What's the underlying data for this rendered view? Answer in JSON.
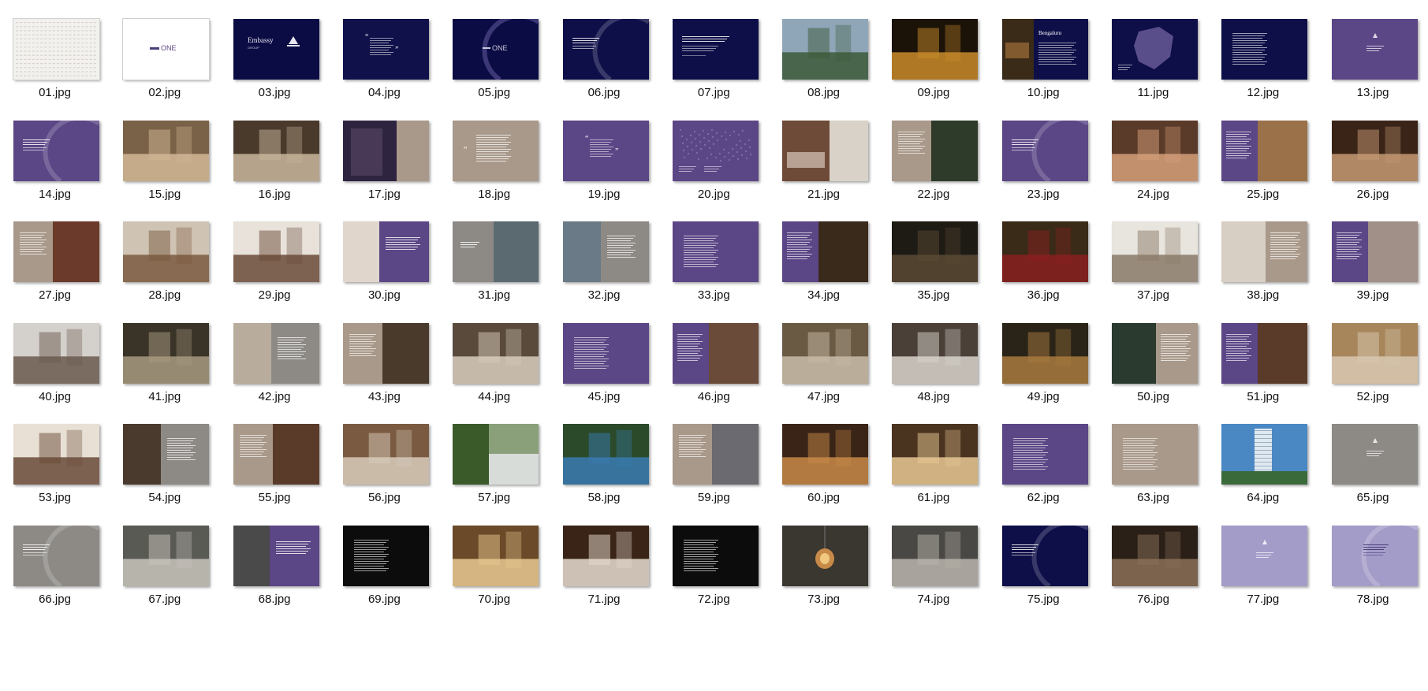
{
  "window": {
    "view": "large-icons",
    "background": "#ffffff"
  },
  "files": [
    {
      "name": "01.jpg",
      "kind": "text-texture",
      "bg": "#f3f1ee"
    },
    {
      "name": "02.jpg",
      "kind": "logo-light",
      "bg": "#ffffff"
    },
    {
      "name": "03.jpg",
      "kind": "logo-dark",
      "bg": "#0c0c45"
    },
    {
      "name": "04.jpg",
      "kind": "quote",
      "bg": "#10104a"
    },
    {
      "name": "05.jpg",
      "kind": "logo-arc",
      "bg": "#0c0c45"
    },
    {
      "name": "06.jpg",
      "kind": "heading-arc",
      "bg": "#0e0e48"
    },
    {
      "name": "07.jpg",
      "kind": "heading",
      "bg": "#0e0e48"
    },
    {
      "name": "08.jpg",
      "kind": "photo",
      "bg": "#8fa6b8",
      "bg2": "#3d5a3a"
    },
    {
      "name": "09.jpg",
      "kind": "photo",
      "bg": "#1b1208",
      "bg2": "#c98b2a"
    },
    {
      "name": "10.jpg",
      "kind": "split-photo-dark",
      "bg": "#0e0e48",
      "bg2": "#3a2a18"
    },
    {
      "name": "11.jpg",
      "kind": "map",
      "bg": "#0e0e48",
      "bg2": "#5a4e8a"
    },
    {
      "name": "12.jpg",
      "kind": "text-dark",
      "bg": "#0e0e48"
    },
    {
      "name": "13.jpg",
      "kind": "logo-purple",
      "bg": "#5b4686"
    },
    {
      "name": "14.jpg",
      "kind": "heading-arc",
      "bg": "#5b4686"
    },
    {
      "name": "15.jpg",
      "kind": "photo",
      "bg": "#7a6248",
      "bg2": "#d2b896"
    },
    {
      "name": "16.jpg",
      "kind": "photo",
      "bg": "#4a3a2c",
      "bg2": "#c8b69c"
    },
    {
      "name": "17.jpg",
      "kind": "split-photo-taupe",
      "bg": "#2e2440",
      "bg2": "#a9998a"
    },
    {
      "name": "18.jpg",
      "kind": "quote-taupe",
      "bg": "#a9998a"
    },
    {
      "name": "19.jpg",
      "kind": "quote",
      "bg": "#5b4686"
    },
    {
      "name": "20.jpg",
      "kind": "map-world",
      "bg": "#5b4686",
      "bg2": "#7d6ba3"
    },
    {
      "name": "21.jpg",
      "kind": "split-photo-light",
      "bg": "#6e4a38",
      "bg2": "#d8d2c8"
    },
    {
      "name": "22.jpg",
      "kind": "split-photo-taupe-left",
      "bg": "#a9998a",
      "bg2": "#2e3a2a"
    },
    {
      "name": "23.jpg",
      "kind": "heading-arc",
      "bg": "#5b4686"
    },
    {
      "name": "24.jpg",
      "kind": "photo",
      "bg": "#5a3a28",
      "bg2": "#d6a07a"
    },
    {
      "name": "25.jpg",
      "kind": "split-photo-purple",
      "bg": "#5b4686",
      "bg2": "#9a7148"
    },
    {
      "name": "26.jpg",
      "kind": "photo",
      "bg": "#3a2418",
      "bg2": "#c79a74"
    },
    {
      "name": "27.jpg",
      "kind": "split-photo-taupe-left",
      "bg": "#a9998a",
      "bg2": "#6b3a2a"
    },
    {
      "name": "28.jpg",
      "kind": "photo",
      "bg": "#cfc4b4",
      "bg2": "#7a5a40"
    },
    {
      "name": "29.jpg",
      "kind": "photo",
      "bg": "#e8e2da",
      "bg2": "#6a4a38"
    },
    {
      "name": "30.jpg",
      "kind": "split-photo-purple-right",
      "bg": "#5b4686",
      "bg2": "#e0d6cc"
    },
    {
      "name": "31.jpg",
      "kind": "split-photo-grey",
      "bg": "#8d8a86",
      "bg2": "#5a6a70"
    },
    {
      "name": "32.jpg",
      "kind": "split-photo-grey-right",
      "bg": "#8d8a86",
      "bg2": "#6a7a86"
    },
    {
      "name": "33.jpg",
      "kind": "text-purple",
      "bg": "#5b4686"
    },
    {
      "name": "34.jpg",
      "kind": "split-photo-purple",
      "bg": "#5b4686",
      "bg2": "#3a2a1c"
    },
    {
      "name": "35.jpg",
      "kind": "photo",
      "bg": "#1e1a14",
      "bg2": "#5a4a34"
    },
    {
      "name": "36.jpg",
      "kind": "photo",
      "bg": "#3a2a18",
      "bg2": "#8a2020"
    },
    {
      "name": "37.jpg",
      "kind": "photo",
      "bg": "#e8e4de",
      "bg2": "#8a7a68"
    },
    {
      "name": "38.jpg",
      "kind": "split-photo-taupe-right",
      "bg": "#a9998a",
      "bg2": "#d8cfc4"
    },
    {
      "name": "39.jpg",
      "kind": "split-photo-purple",
      "bg": "#5b4686",
      "bg2": "#a09088"
    },
    {
      "name": "40.jpg",
      "kind": "photo",
      "bg": "#d4d0cc",
      "bg2": "#6a5a4e"
    },
    {
      "name": "41.jpg",
      "kind": "photo",
      "bg": "#3a3428",
      "bg2": "#a89a80"
    },
    {
      "name": "42.jpg",
      "kind": "split-photo-grey-right",
      "bg": "#8d8a86",
      "bg2": "#b8ac9c"
    },
    {
      "name": "43.jpg",
      "kind": "split-photo-taupe-left",
      "bg": "#a9998a",
      "bg2": "#4a3a2c"
    },
    {
      "name": "44.jpg",
      "kind": "photo",
      "bg": "#5a4a3c",
      "bg2": "#d8cdbc"
    },
    {
      "name": "45.jpg",
      "kind": "text-purple",
      "bg": "#5b4686"
    },
    {
      "name": "46.jpg",
      "kind": "split-photo-purple",
      "bg": "#5b4686",
      "bg2": "#6a4a38"
    },
    {
      "name": "47.jpg",
      "kind": "photo",
      "bg": "#6a5a44",
      "bg2": "#c8bca8"
    },
    {
      "name": "48.jpg",
      "kind": "photo",
      "bg": "#4a4038",
      "bg2": "#d8d4cc"
    },
    {
      "name": "49.jpg",
      "kind": "photo",
      "bg": "#2a2418",
      "bg2": "#a87a40"
    },
    {
      "name": "50.jpg",
      "kind": "split-photo-taupe-right",
      "bg": "#a9998a",
      "bg2": "#2a3a2e"
    },
    {
      "name": "51.jpg",
      "kind": "split-photo-purple",
      "bg": "#5b4686",
      "bg2": "#5a3a28"
    },
    {
      "name": "52.jpg",
      "kind": "photo",
      "bg": "#a8865c",
      "bg2": "#d8c8b0"
    },
    {
      "name": "53.jpg",
      "kind": "photo",
      "bg": "#e8e0d4",
      "bg2": "#6a4a38"
    },
    {
      "name": "54.jpg",
      "kind": "split-photo-grey-right",
      "bg": "#8d8a86",
      "bg2": "#4a3a2e"
    },
    {
      "name": "55.jpg",
      "kind": "split-photo-taupe-left",
      "bg": "#a9998a",
      "bg2": "#5a3a28"
    },
    {
      "name": "56.jpg",
      "kind": "photo",
      "bg": "#7a5a40",
      "bg2": "#d8ccbc"
    },
    {
      "name": "57.jpg",
      "kind": "split-photo-green",
      "bg": "#3a5a2a",
      "bg2": "#8aa07a"
    },
    {
      "name": "58.jpg",
      "kind": "photo",
      "bg": "#2a4a2a",
      "bg2": "#3a7ab0"
    },
    {
      "name": "59.jpg",
      "kind": "split-photo-taupe-left",
      "bg": "#a9998a",
      "bg2": "#6a6a70"
    },
    {
      "name": "60.jpg",
      "kind": "photo",
      "bg": "#3a2418",
      "bg2": "#c88a48"
    },
    {
      "name": "61.jpg",
      "kind": "photo",
      "bg": "#4a3420",
      "bg2": "#e8c894"
    },
    {
      "name": "62.jpg",
      "kind": "text-purple",
      "bg": "#5b4686"
    },
    {
      "name": "63.jpg",
      "kind": "text-taupe",
      "bg": "#a9998a"
    },
    {
      "name": "64.jpg",
      "kind": "photo-tower",
      "bg": "#4a88c4",
      "bg2": "#e0e8f0"
    },
    {
      "name": "65.jpg",
      "kind": "logo-grey",
      "bg": "#8d8a86"
    },
    {
      "name": "66.jpg",
      "kind": "heading-arc",
      "bg": "#8d8a86"
    },
    {
      "name": "67.jpg",
      "kind": "photo",
      "bg": "#5a5a54",
      "bg2": "#c8c4bc"
    },
    {
      "name": "68.jpg",
      "kind": "split-photo-purple-right",
      "bg": "#5b4686",
      "bg2": "#4a4a4a"
    },
    {
      "name": "69.jpg",
      "kind": "text-black",
      "bg": "#0c0c0c"
    },
    {
      "name": "70.jpg",
      "kind": "photo",
      "bg": "#6a4a28",
      "bg2": "#e8c890"
    },
    {
      "name": "71.jpg",
      "kind": "photo",
      "bg": "#3a2418",
      "bg2": "#e8dcd0"
    },
    {
      "name": "72.jpg",
      "kind": "text-black",
      "bg": "#0c0c0c"
    },
    {
      "name": "73.jpg",
      "kind": "photo-lamp",
      "bg": "#3a3630",
      "bg2": "#c88a48"
    },
    {
      "name": "74.jpg",
      "kind": "photo",
      "bg": "#4a4844",
      "bg2": "#b8b4ac"
    },
    {
      "name": "75.jpg",
      "kind": "heading-arc",
      "bg": "#0e0e48"
    },
    {
      "name": "76.jpg",
      "kind": "photo",
      "bg": "#2a2018",
      "bg2": "#8a7058"
    },
    {
      "name": "77.jpg",
      "kind": "logo-lavender",
      "bg": "#a49cc8"
    },
    {
      "name": "78.jpg",
      "kind": "heading-arc-lavender",
      "bg": "#a49cc8"
    }
  ]
}
